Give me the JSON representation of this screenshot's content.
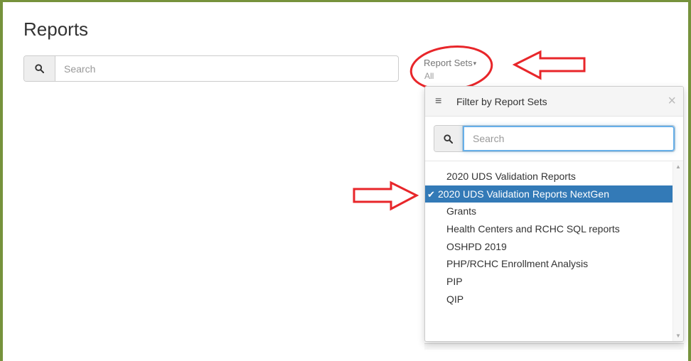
{
  "page": {
    "title": "Reports"
  },
  "search": {
    "placeholder": "Search",
    "icon": "search-icon"
  },
  "report_sets": {
    "label": "Report Sets",
    "caret": "▾",
    "value": "All"
  },
  "dropdown": {
    "title": "Filter by Report Sets",
    "menu_glyph": "≡",
    "close_glyph": "×",
    "search_placeholder": "Search",
    "check_glyph": "✔",
    "items": [
      {
        "label": "2020 UDS Validation Reports",
        "selected": false
      },
      {
        "label": "2020 UDS Validation Reports NextGen",
        "selected": true
      },
      {
        "label": "Grants",
        "selected": false
      },
      {
        "label": "Health Centers and RCHC SQL reports",
        "selected": false
      },
      {
        "label": "OSHPD 2019",
        "selected": false
      },
      {
        "label": "PHP/RCHC Enrollment Analysis",
        "selected": false
      },
      {
        "label": "PIP",
        "selected": false
      },
      {
        "label": "QIP",
        "selected": false
      }
    ]
  },
  "colors": {
    "frame_border": "#76923c",
    "selected_bg": "#337ab7",
    "annotation_red": "#e8262a",
    "focus_blue": "#66afe9"
  }
}
